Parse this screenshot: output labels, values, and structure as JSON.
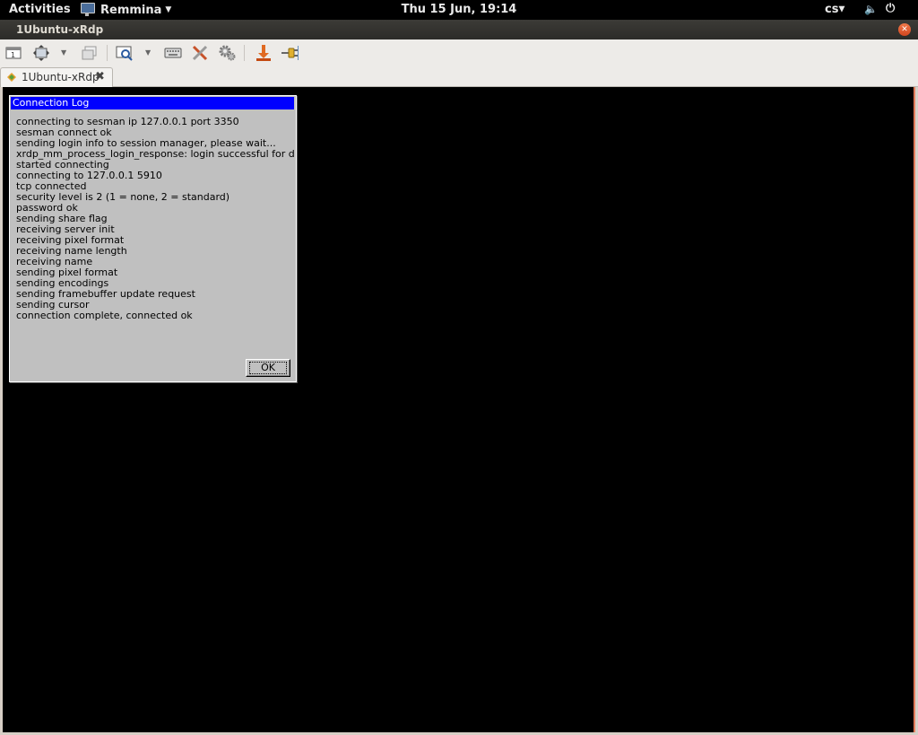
{
  "topbar": {
    "activities": "Activities",
    "app_name": "Remmina",
    "clock": "Thu 15 Jun, 19:14",
    "language": "cs"
  },
  "window": {
    "title": "1Ubuntu-xRdp"
  },
  "tabs": [
    {
      "label": "1Ubuntu-xRdp"
    }
  ],
  "dialog": {
    "title": "Connection Log",
    "lines": [
      "connecting to sesman ip 127.0.0.1 port 3350",
      "sesman connect ok",
      "sending login info to session manager, please wait...",
      "xrdp_mm_process_login_response: login successful for displa",
      "started connecting",
      "connecting to 127.0.0.1 5910",
      "tcp connected",
      "security level is 2 (1 = none, 2 = standard)",
      "password ok",
      "sending share flag",
      "receiving server init",
      "receiving pixel format",
      "receiving name length",
      "receiving name",
      "sending pixel format",
      "sending encodings",
      "sending framebuffer update request",
      "sending cursor",
      "connection complete, connected ok"
    ],
    "ok_label": "OK"
  },
  "colors": {
    "dialog_titlebar": "#0000ff",
    "dialog_bg": "#c0c0c0",
    "remote_bg": "#000000"
  }
}
